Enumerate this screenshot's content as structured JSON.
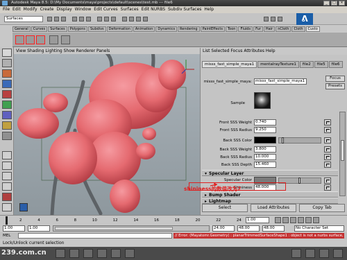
{
  "window": {
    "title": "Autodesk Maya 8.5: D:\\My Documents\\maya\\projects\\default\\scenes\\test.mb  ---  file6"
  },
  "menubar": {
    "items": [
      "File",
      "Edit",
      "Modify",
      "Create",
      "Display",
      "Window",
      "Edit Curves",
      "Surfaces",
      "Edit NURBS",
      "Subdiv Surfaces",
      "Help"
    ]
  },
  "statusline": {
    "mode": "Surfaces"
  },
  "shelf": {
    "tabs": [
      "General",
      "Curves",
      "Surfaces",
      "Polygons",
      "Subdivs",
      "Deformation",
      "Animation",
      "Dynamics",
      "Rendering",
      "PaintEffects",
      "Toon",
      "Fluids",
      "Fur",
      "Hair",
      "nCloth",
      "Cloth",
      "Custo"
    ],
    "active_tab": "Custom"
  },
  "viewport": {
    "menu": "View  Shading  Lighting  Show  Renderer  Panels"
  },
  "attribute_editor": {
    "menu": "List  Selected  Focus  Attributes  Help",
    "tabs": [
      "misss_fast_simple_maya1",
      "mentalrayTexture1",
      "file2",
      "file5",
      "file6"
    ],
    "node_label": "misss_fast_simple_maya:",
    "node_value": "misss_fast_simple_maya1",
    "focus_label": "Focus",
    "presets_label": "Presets",
    "sample_label": "Sample",
    "attrs": [
      {
        "label": "Front SSS Weight",
        "value": "0.740"
      },
      {
        "label": "Front SSS Radius",
        "value": "9.250"
      },
      {
        "label": "Back SSS Color",
        "value": ""
      },
      {
        "label": "Back SSS Weight",
        "value": "3.800"
      },
      {
        "label": "Back SSS Radius",
        "value": "10.000"
      },
      {
        "label": "Back SSS Depth",
        "value": "15.460"
      }
    ],
    "specular_section": "Specular Layer",
    "specular_color_label": "Specular Color",
    "shininess_label": "Shininess",
    "shininess_value": "48.000",
    "bump_section": "Bump Shader",
    "lightmap_section": "Lightmap",
    "buttons": {
      "select": "Select",
      "load": "Load Attributes",
      "copy": "Copy Tab"
    }
  },
  "timeline": {
    "ticks": [
      "2",
      "4",
      "6",
      "8",
      "10",
      "12",
      "14",
      "16",
      "18",
      "20",
      "22",
      "24"
    ],
    "current_frame": "1.00"
  },
  "range": {
    "start": "1.00",
    "range_start": "1.00",
    "range_end": "24.00",
    "end_a": "48.00",
    "end_b": "48.00",
    "character": "No Character Set"
  },
  "commandline": {
    "lang": "MEL",
    "error": "// Error: (Mayatomr.Geometry) : planarTrimmedSurfaceShape1 : object is not a nurbs surface, ignored"
  },
  "helpline": {
    "text": "Lock/Unlock current selection"
  },
  "annotation": {
    "text": "shininess的数值改为2"
  },
  "watermark": "239.com.cn",
  "colors": {
    "shape": "#e56a70",
    "stem": "#5d6266",
    "annotation": "#e02020",
    "titlebar": "#2d2d2d"
  },
  "icons": [
    "select-arrow-icon",
    "lasso-icon",
    "paint-icon",
    "move-icon",
    "rotate-icon",
    "scale-icon",
    "maya-logo-icon"
  ]
}
